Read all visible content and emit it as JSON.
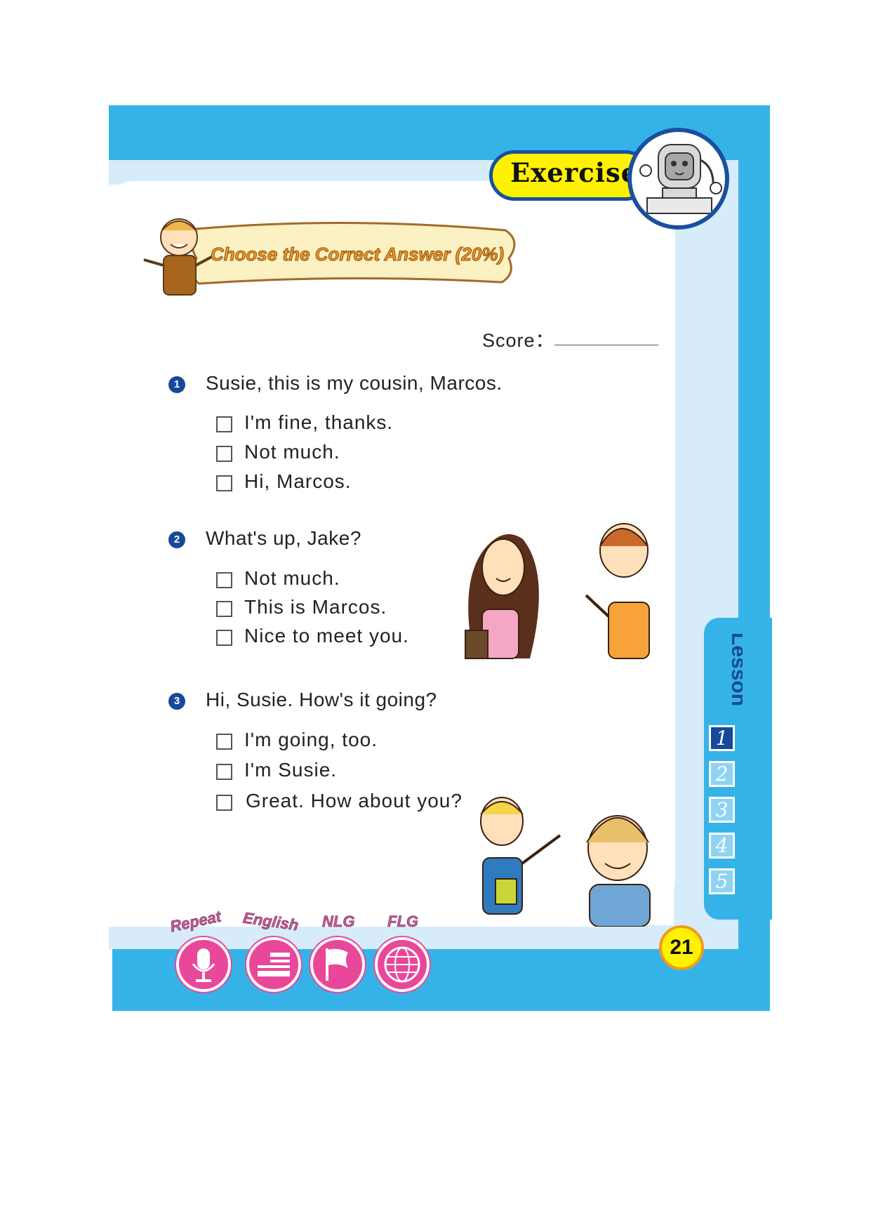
{
  "header": {
    "exercise_label": "Exercise"
  },
  "banner": {
    "title": "Choose the Correct Answer (20%)"
  },
  "score": {
    "label": "Score："
  },
  "questions": [
    {
      "number": "1",
      "prompt": "Susie, this is my cousin, Marcos.",
      "options": [
        "I'm fine, thanks.",
        "Not much.",
        "Hi, Marcos."
      ]
    },
    {
      "number": "2",
      "prompt": "What's up, Jake?",
      "options": [
        "Not much.",
        "This is Marcos.",
        "Nice to meet you."
      ]
    },
    {
      "number": "3",
      "prompt": "Hi, Susie. How's it going?",
      "options": [
        "I'm going, too.",
        "I'm Susie.",
        "Great. How about you?"
      ]
    }
  ],
  "lesson_tab": {
    "label": "Lesson",
    "items": [
      "1",
      "2",
      "3",
      "4",
      "5"
    ],
    "active": "1"
  },
  "page_number": "21",
  "bottom_icons": [
    {
      "caption": "Repeat",
      "icon": "microphone-icon"
    },
    {
      "caption": "English",
      "icon": "us-flag-icon"
    },
    {
      "caption": "NLG",
      "icon": "flag-icon"
    },
    {
      "caption": "FLG",
      "icon": "globe-icon"
    }
  ],
  "colors": {
    "frame_blue": "#35b3e8",
    "navy": "#17489a",
    "yellow": "#fff200",
    "pink": "#e8479a",
    "orange": "#f39a1e"
  }
}
